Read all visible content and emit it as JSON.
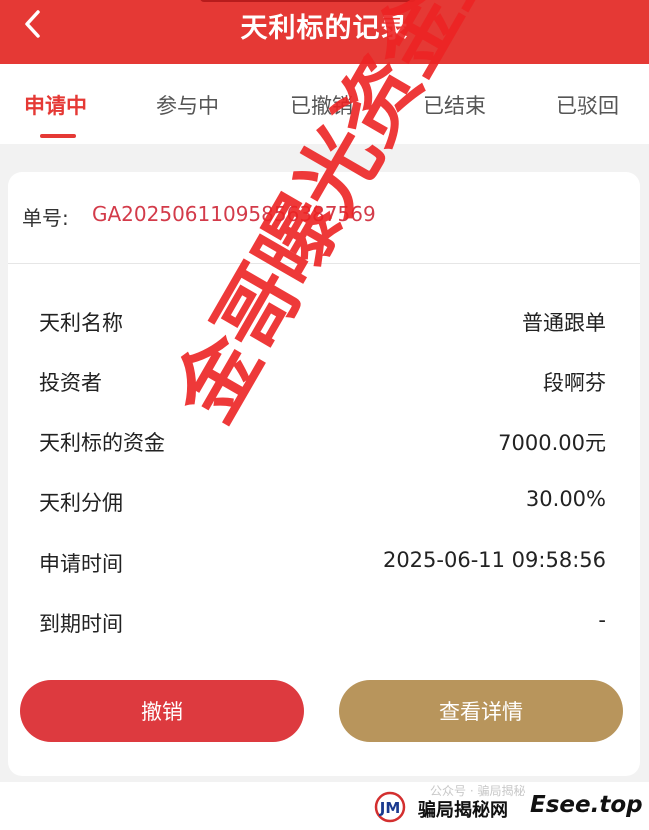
{
  "header": {
    "title": "天利标的记录",
    "back_icon": "chevron-left-icon"
  },
  "tabs": [
    {
      "label": "申请中",
      "active": true
    },
    {
      "label": "参与中",
      "active": false
    },
    {
      "label": "已撤销",
      "active": false
    },
    {
      "label": "已结束",
      "active": false
    },
    {
      "label": "已驳回",
      "active": false
    }
  ],
  "record": {
    "order_label": "单号:",
    "order_no": "GA2025061109585638​7569",
    "fields": [
      {
        "label": "天利名称",
        "value": "普通跟单"
      },
      {
        "label": "投资者",
        "value": "段啊芬"
      },
      {
        "label": "天利标的资金",
        "value": "7000.00元"
      },
      {
        "label": "天利分佣",
        "value": "30.00%"
      },
      {
        "label": "申请时间",
        "value": "2025-06-11 09:58:56"
      },
      {
        "label": "到期时间",
        "value": "-"
      }
    ],
    "cancel_button": "撤销",
    "detail_button": "查看详情"
  },
  "watermark": {
    "text": "金哥曝光资金盘骗局",
    "color": "#ec2424"
  },
  "footer": {
    "logo_text": "JM",
    "site_name": "骗局揭秘网",
    "domain": "Esee.top",
    "faint_text": "公众号 · 骗局揭秘"
  },
  "colors": {
    "primary_red": "#e53935",
    "order_red": "#d33b4a",
    "gold": "#b8955c"
  }
}
